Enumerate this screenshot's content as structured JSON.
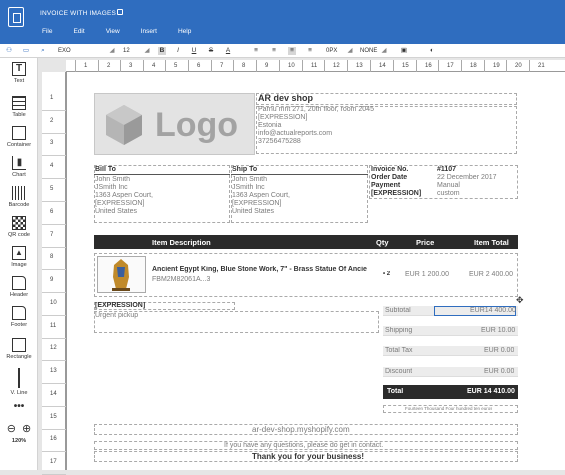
{
  "app": {
    "doc_title": "INVOICE WITH IMAGES",
    "menu": [
      "File",
      "Edit",
      "View",
      "Insert",
      "Help"
    ]
  },
  "toolbar": {
    "font": "EXO",
    "font_size": "12",
    "bold": "B",
    "italic": "I",
    "underline": "U",
    "strike": "S",
    "text_color": "A",
    "spacing": "0PX",
    "border": "NONE"
  },
  "sidebar": {
    "items": [
      "Text",
      "Table",
      "Container",
      "Chart",
      "Barcode",
      "QR code",
      "Image",
      "Header",
      "Footer",
      "Rectangle",
      "V. Line"
    ],
    "zoom": "120%"
  },
  "ruler": {
    "top": [
      "1",
      "2",
      "3",
      "4",
      "5",
      "6",
      "7",
      "8",
      "9",
      "10",
      "11",
      "12",
      "13",
      "14",
      "15",
      "16",
      "17",
      "18",
      "19",
      "20",
      "21"
    ],
    "left": [
      "1",
      "2",
      "3",
      "4",
      "5",
      "6",
      "7",
      "8",
      "9",
      "10",
      "11",
      "12",
      "13",
      "14",
      "15",
      "16",
      "17"
    ]
  },
  "invoice": {
    "logo_text": "Logo",
    "company": "AR dev shop",
    "address": [
      "Parnu mnt 271, 20th floor, room 2045",
      "[EXPRESSION]",
      "Estonia",
      "info@actualreports.com",
      "37256475288"
    ],
    "bill_to_label": "Bill To",
    "bill_to": [
      "John Smith",
      "JSmith Inc",
      "1363 Aspen Court,",
      "[EXPRESSION]",
      "United States"
    ],
    "ship_to_label": "Ship To",
    "ship_to": [
      "John Smith",
      "JSmith Inc",
      "1363 Aspen Court,",
      "[EXPRESSION]",
      "United States"
    ],
    "meta_labels": [
      "Invoice No.",
      "Order Date",
      "Payment",
      "[EXPRESSION]"
    ],
    "meta_values": [
      "#1107",
      "22 December 2017",
      "Manual",
      "custom"
    ],
    "headers": {
      "desc": "Item Description",
      "qty": "Qty",
      "price": "Price",
      "total": "Item Total"
    },
    "item": {
      "name": "Ancient Egypt King, Blue Stone Work, 7\" - Brass Statue Of Ancient",
      "sku": "FBM2M82061A...3",
      "qty": "• 2",
      "price": "EUR 1 200.00",
      "total": "EUR 2 400.00"
    },
    "expr": "[EXPRESSION]",
    "note": "Urgent pickup",
    "summary_labels": [
      "Subtotal",
      "Shipping",
      "Total Tax",
      "Discount"
    ],
    "summary_values": [
      "EUR14 400.00",
      "EUR 10.00",
      "EUR 0.00",
      "EUR 0.00"
    ],
    "total_label": "Total",
    "total_value": "EUR 14 410.00",
    "words": "Fourteen Thousand Four hundred ten euros",
    "website": "ar-dev-shop.myshopify.com",
    "questions": "If you have any questions, please do get in contact.",
    "thanks": "Thank you for your business!"
  }
}
